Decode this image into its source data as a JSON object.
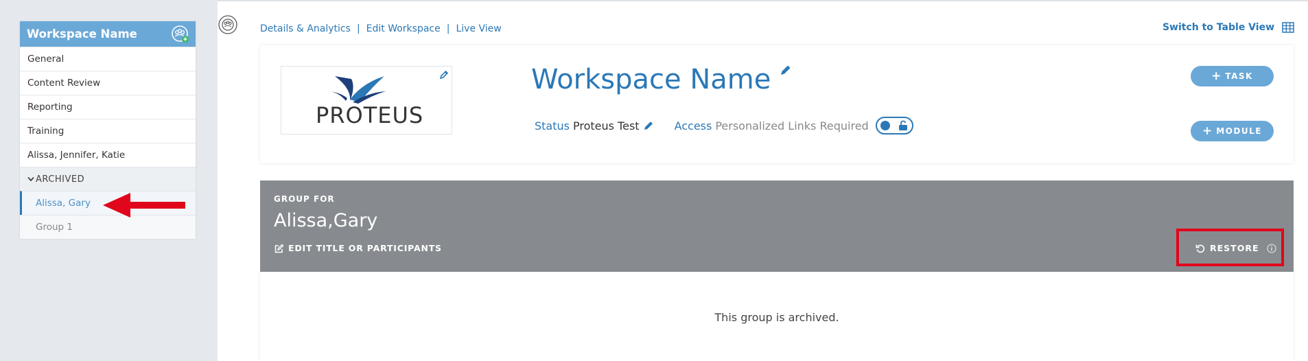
{
  "sidebar": {
    "workspace_title": "Workspace Name",
    "items": [
      {
        "label": "General"
      },
      {
        "label": "Content Review"
      },
      {
        "label": "Reporting"
      },
      {
        "label": "Training"
      },
      {
        "label": "Alissa, Jennifer, Katie"
      }
    ],
    "archived_label": "ARCHIVED",
    "archived_items": [
      {
        "label": "Alissa, Gary",
        "active": true
      },
      {
        "label": "Group 1",
        "active": false
      }
    ]
  },
  "top_nav": {
    "links": [
      "Details & Analytics",
      "Edit Workspace",
      "Live View"
    ],
    "separator": "|",
    "switch_view_label": "Switch to Table View"
  },
  "workspace": {
    "logo_text": "PROTEUS",
    "name": "Workspace Name",
    "status_label": "Status",
    "status_value": "Proteus Test",
    "access_label": "Access",
    "access_value": "Personalized Links Required",
    "task_button": "TASK",
    "module_button": "MODULE"
  },
  "group": {
    "heading": "GROUP FOR",
    "name": "Alissa,Gary",
    "edit_label": "EDIT TITLE OR PARTICIPANTS",
    "restore_label": "RESTORE",
    "archived_message": "This group is archived."
  },
  "colors": {
    "accent": "#2b78b6",
    "header_blue": "#6aa8d7",
    "band_grey": "#878b8f",
    "highlight_red": "#e0061b"
  }
}
